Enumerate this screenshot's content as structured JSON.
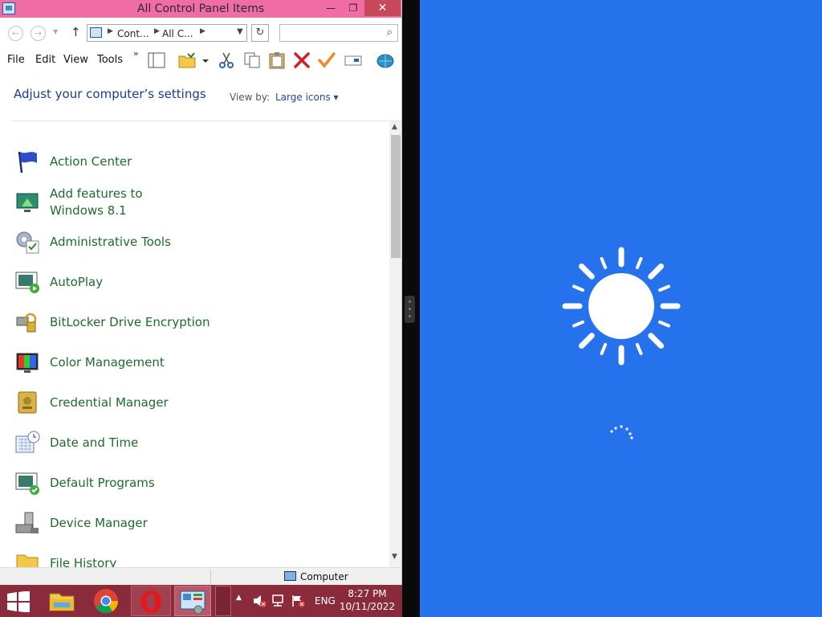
{
  "window": {
    "title": "All Control Panel Items",
    "title_min": "—",
    "title_max": "❐",
    "title_close": "✕"
  },
  "address": {
    "crumb1": "Cont...",
    "crumb2": "All C...",
    "search_placeholder": ""
  },
  "menu": {
    "file": "File",
    "edit": "Edit",
    "view": "View",
    "tools": "Tools",
    "more": "»"
  },
  "header": {
    "title": "Adjust your computer’s settings",
    "view_by_label": "View by:",
    "view_by_value": "Large icons ▾"
  },
  "items": [
    {
      "label": "Action Center",
      "icon": "action-center-flag-icon"
    },
    {
      "label": "Add features to Windows 8.1",
      "icon": "add-features-icon"
    },
    {
      "label": "Administrative Tools",
      "icon": "administrative-tools-icon"
    },
    {
      "label": "AutoPlay",
      "icon": "autoplay-icon"
    },
    {
      "label": "BitLocker Drive Encryption",
      "icon": "bitlocker-icon"
    },
    {
      "label": "Color Management",
      "icon": "color-management-icon"
    },
    {
      "label": "Credential Manager",
      "icon": "credential-manager-icon"
    },
    {
      "label": "Date and Time",
      "icon": "date-time-icon"
    },
    {
      "label": "Default Programs",
      "icon": "default-programs-icon"
    },
    {
      "label": "Device Manager",
      "icon": "device-manager-icon"
    },
    {
      "label": "File History",
      "icon": "file-history-icon"
    }
  ],
  "statusbar": {
    "location": "Computer"
  },
  "taskbar": {
    "lang": "ENG",
    "time": "8:27 PM",
    "date": "10/11/2022"
  },
  "colors": {
    "titlebar": "#f06ca5",
    "blue_pane": "#2672ec",
    "taskbar": "#8a2b3b",
    "item_text": "#1e6b2e"
  }
}
